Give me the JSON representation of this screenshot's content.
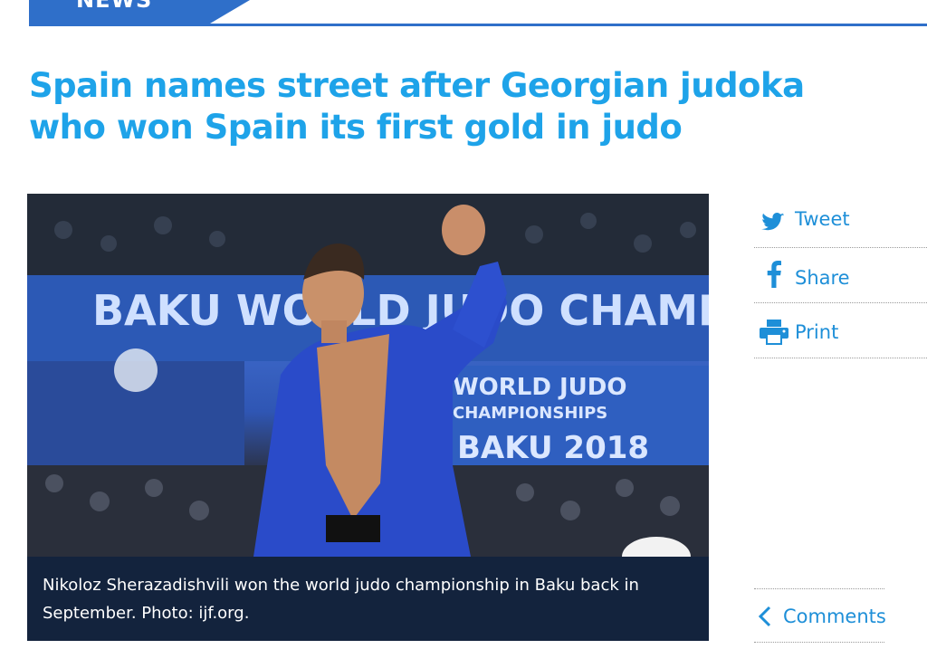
{
  "section": {
    "tab_label": "NEWS"
  },
  "article": {
    "headline": "Spain names street after Georgian judoka who won Spain its first gold in judo",
    "photo": {
      "banner_text": "BAKU WORLD JUDO CHAMPIO",
      "sign_line1": "WORLD JUDO",
      "sign_line2": "CHAMPIONSHIPS",
      "sign_line3": "BAKU 2018",
      "caption": "Nikoloz Sherazadishvili won the world judo championship in Baku back in September. Photo: ijf.org."
    }
  },
  "share": {
    "tweet_label": "Tweet",
    "share_label": "Share",
    "print_label": "Print",
    "comments_label": "Comments",
    "icons": [
      "twitter-bird-icon",
      "facebook-f-icon",
      "printer-icon",
      "chevron-left-icon"
    ],
    "link_color": "#1e8fd8"
  },
  "colors": {
    "headline": "#1ea3e9",
    "nav_blue": "#2f6fc9",
    "caption_bg": "#13233d"
  }
}
